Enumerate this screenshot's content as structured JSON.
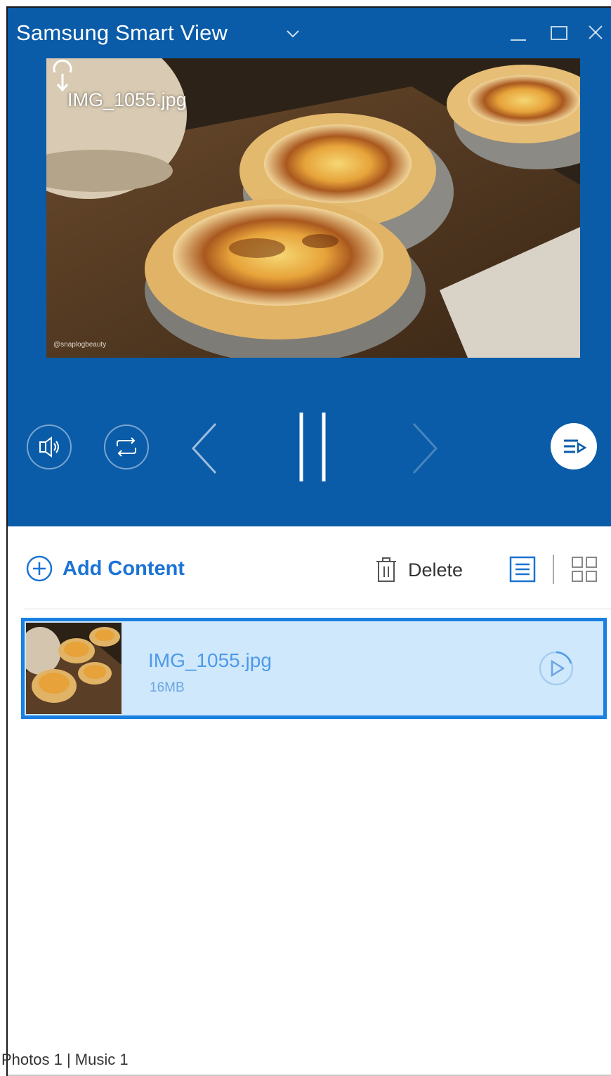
{
  "window": {
    "title": "Samsung Smart View"
  },
  "preview": {
    "filename": "IMG_1055.jpg",
    "watermark": "@snaplogbeauty"
  },
  "toolbar": {
    "add_label": "Add Content",
    "delete_label": "Delete"
  },
  "items": [
    {
      "name": "IMG_1055.jpg",
      "size": "16MB",
      "selected": true
    }
  ],
  "status": {
    "text": "Photos 1 | Music 1"
  },
  "colors": {
    "player_bg": "#0a5ca8",
    "accent": "#1a73d4",
    "selected_row_bg": "#cfe8fc",
    "selected_row_border": "#1a7fe0"
  }
}
